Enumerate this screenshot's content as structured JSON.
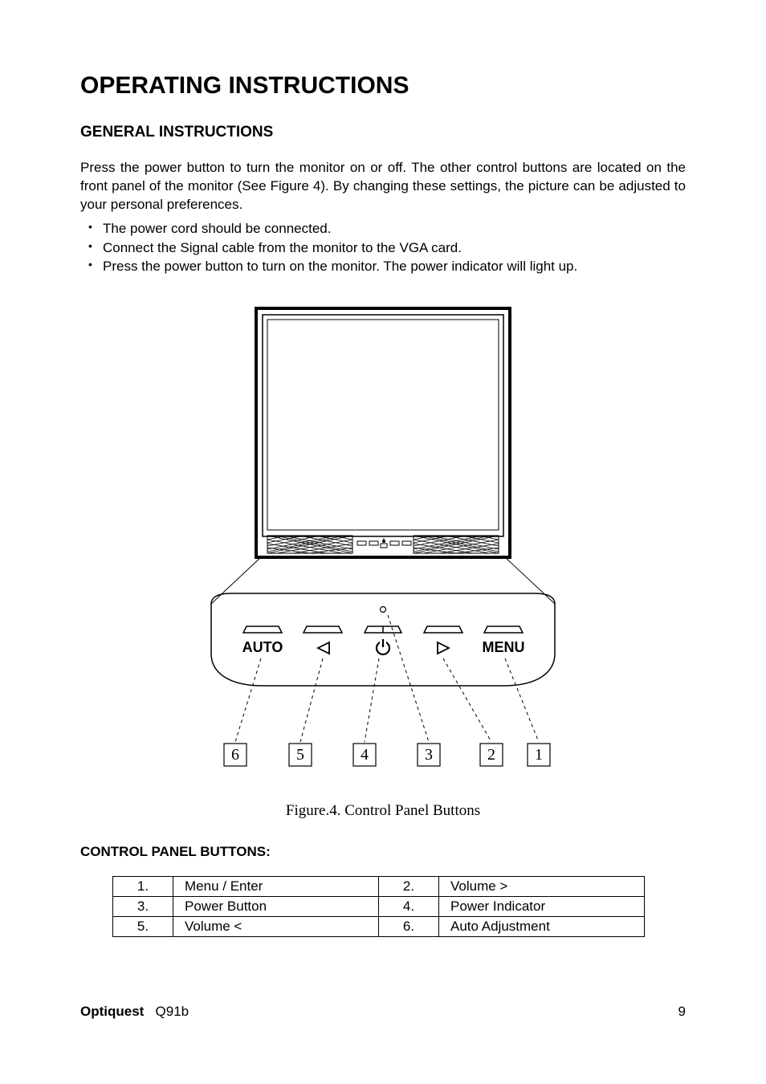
{
  "title": "OPERATING INSTRUCTIONS",
  "general": {
    "heading": "GENERAL INSTRUCTIONS",
    "intro": "Press the power button to turn the monitor on or off. The other control buttons are located on the front panel of the monitor (See Figure 4). By changing these settings, the picture can be adjusted to your personal preferences.",
    "bullets": [
      "The power cord should be connected.",
      "Connect the Signal cable from the monitor to the VGA card.",
      "Press the power button to turn on the monitor. The power indicator will light up."
    ]
  },
  "figure": {
    "caption": "Figure.4. Control Panel Buttons",
    "labels": {
      "auto": "AUTO",
      "menu": "MENU",
      "n1": "1",
      "n2": "2",
      "n3": "3",
      "n4": "4",
      "n5": "5",
      "n6": "6"
    }
  },
  "control_panel": {
    "heading": "CONTROL PANEL BUTTONS:",
    "rows": [
      {
        "a_num": "1.",
        "a_label": "Menu / Enter",
        "b_num": "2.",
        "b_label": "Volume >"
      },
      {
        "a_num": "3.",
        "a_label": "Power Button",
        "b_num": "4.",
        "b_label": "Power Indicator"
      },
      {
        "a_num": "5.",
        "a_label": "Volume <",
        "b_num": "6.",
        "b_label": "Auto Adjustment"
      }
    ]
  },
  "footer": {
    "brand": "Optiquest",
    "model": "Q91b",
    "page": "9"
  }
}
